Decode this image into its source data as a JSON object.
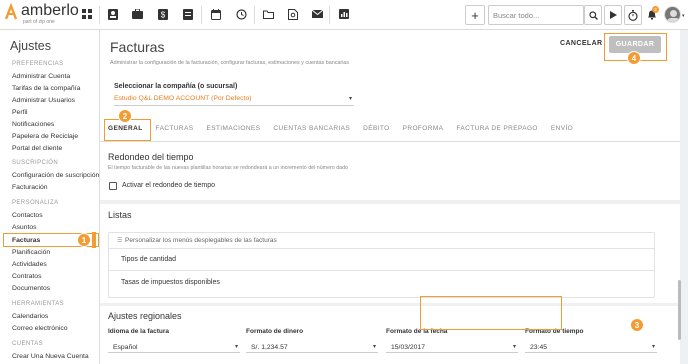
{
  "app": {
    "brand": "amberlo",
    "brand_sub": "part of zip one"
  },
  "topbar": {
    "search_placeholder": "Buscar todo...",
    "notif_count": "2"
  },
  "sidebar": {
    "title": "Ajustes",
    "groups": [
      {
        "label": "PREFERENCIAS",
        "items": [
          "Administrar Cuenta",
          "Tarifas de la compañía",
          "Administrar Usuarios",
          "Perfil",
          "Notificaciones",
          "Papelera de Reciclaje",
          "Portal del cliente"
        ]
      },
      {
        "label": "SUSCRIPCIÓN",
        "items": [
          "Configuración de suscripción",
          "Facturación"
        ]
      },
      {
        "label": "PERSONALIZA",
        "items": [
          "Contactos",
          "Asuntos",
          "Facturas",
          "Planificación",
          "Actividades",
          "Contratos",
          "Documentos"
        ]
      },
      {
        "label": "HERRAMIENTAS",
        "items": [
          "Calendarios",
          "Correo electrónico"
        ]
      },
      {
        "label": "CUENTAS",
        "items": [
          "Crear Una Nueva Cuenta"
        ]
      }
    ],
    "active": "Facturas"
  },
  "page": {
    "title": "Facturas",
    "subtitle": "Administrar la configuración de la facturación, configurar facturas, estimaciones y cuentas bancarias",
    "cancel": "CANCELAR",
    "save": "GUARDAR",
    "company_label": "Seleccionar la compañía (o sucursal)",
    "company_value": "Estudio Q&L DEMO ACCOUNT (Por Defecto)",
    "tabs": [
      "GENERAL",
      "FACTURAS",
      "ESTIMACIONES",
      "CUENTAS BANCARIAS",
      "DÉBITO",
      "PROFORMA",
      "FACTURA DE PREPAGO",
      "ENVÍO"
    ]
  },
  "rounding": {
    "title": "Redondeo del tiempo",
    "desc": "El tiempo facturable de las nuevas plantillas horarias se redondeará a un incremento del número dado",
    "checkbox": "Activar el redondeo de tiempo"
  },
  "lists": {
    "title": "Listas",
    "customize": "Personalizar los menús desplegables de las facturas",
    "items": [
      "Tipos de cantidad",
      "Tasas de impuestos disponibles"
    ]
  },
  "regional": {
    "title": "Ajustes regionales",
    "fields": [
      {
        "label": "Idioma de la factura",
        "value": "Español"
      },
      {
        "label": "Formato de dinero",
        "value": "S/. 1,234.57"
      },
      {
        "label": "Formato de la fecha",
        "value": "15/03/2017"
      },
      {
        "label": "Formato de tiempo",
        "value": "23:45"
      }
    ]
  },
  "callouts": [
    "1",
    "2",
    "3",
    "4"
  ],
  "colors": {
    "accent": "#f39c34",
    "link": "#e67e22"
  }
}
